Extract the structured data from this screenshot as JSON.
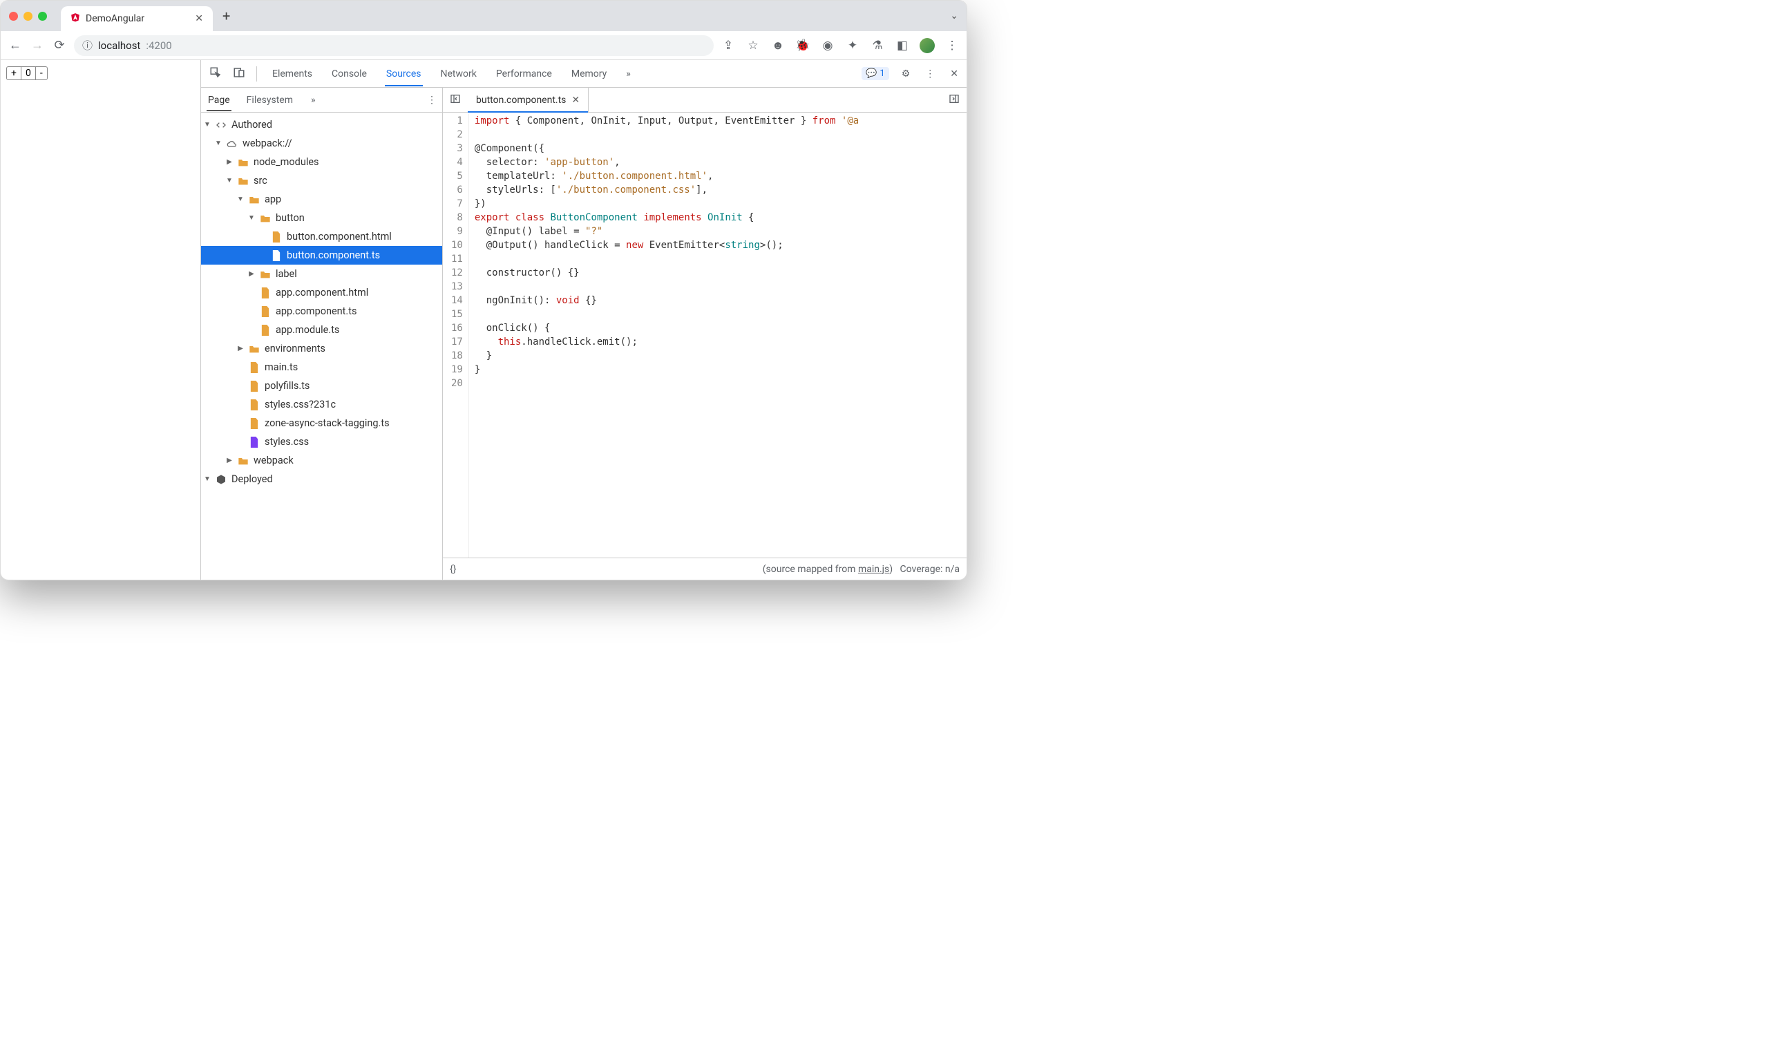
{
  "browser": {
    "tab_title": "DemoAngular",
    "url_host": "localhost",
    "url_port": ":4200",
    "new_tab_plus": "+"
  },
  "page": {
    "stepper_plus": "+",
    "stepper_value": "0",
    "stepper_minus": "-"
  },
  "devtools": {
    "tabs": [
      "Elements",
      "Console",
      "Sources",
      "Network",
      "Performance",
      "Memory"
    ],
    "active_tab": "Sources",
    "more": "»",
    "issues_count": "1"
  },
  "sources": {
    "sub_tabs": [
      "Page",
      "Filesystem"
    ],
    "active_sub": "Page",
    "more": "»"
  },
  "tree": {
    "authored": "Authored",
    "webpack": "webpack://",
    "node_modules": "node_modules",
    "src": "src",
    "app": "app",
    "button_dir": "button",
    "button_html": "button.component.html",
    "button_ts": "button.component.ts",
    "label_dir": "label",
    "app_html": "app.component.html",
    "app_ts": "app.component.ts",
    "app_module": "app.module.ts",
    "environments": "environments",
    "main_ts": "main.ts",
    "polyfills": "polyfills.ts",
    "styles_q": "styles.css?231c",
    "zone": "zone-async-stack-tagging.ts",
    "styles": "styles.css",
    "webpack_dir": "webpack",
    "deployed": "Deployed"
  },
  "file": {
    "open_name": "button.component.ts"
  },
  "code": {
    "lines": 20,
    "l1": "import { Component, OnInit, Input, Output, EventEmitter } from '@a",
    "l3": "@Component({",
    "l4_a": "  selector: ",
    "l4_b": "'app-button'",
    "l4_c": ",",
    "l5_a": "  templateUrl: ",
    "l5_b": "'./button.component.html'",
    "l5_c": ",",
    "l6_a": "  styleUrls: [",
    "l6_b": "'./button.component.css'",
    "l6_c": "],",
    "l7": "})",
    "l8_a": "export",
    "l8_b": " class ",
    "l8_c": "ButtonComponent",
    "l8_d": " implements ",
    "l8_e": "OnInit",
    "l8_f": " {",
    "l9_a": "  @Input() label = ",
    "l9_b": "\"?\"",
    "l10_a": "  @Output() handleClick = ",
    "l10_b": "new",
    "l10_c": " EventEmitter<",
    "l10_d": "string",
    "l10_e": ">();",
    "l12": "  constructor() {}",
    "l14_a": "  ngOnInit(): ",
    "l14_b": "void",
    "l14_c": " {}",
    "l16": "  onClick() {",
    "l17_a": "    ",
    "l17_b": "this",
    "l17_c": ".handleClick.emit();",
    "l18": "  }",
    "l19": "}"
  },
  "status": {
    "braces": "{}",
    "mapped_prefix": "(source mapped from ",
    "mapped_link": "main.js",
    "mapped_suffix": ")",
    "coverage": "Coverage: n/a"
  }
}
